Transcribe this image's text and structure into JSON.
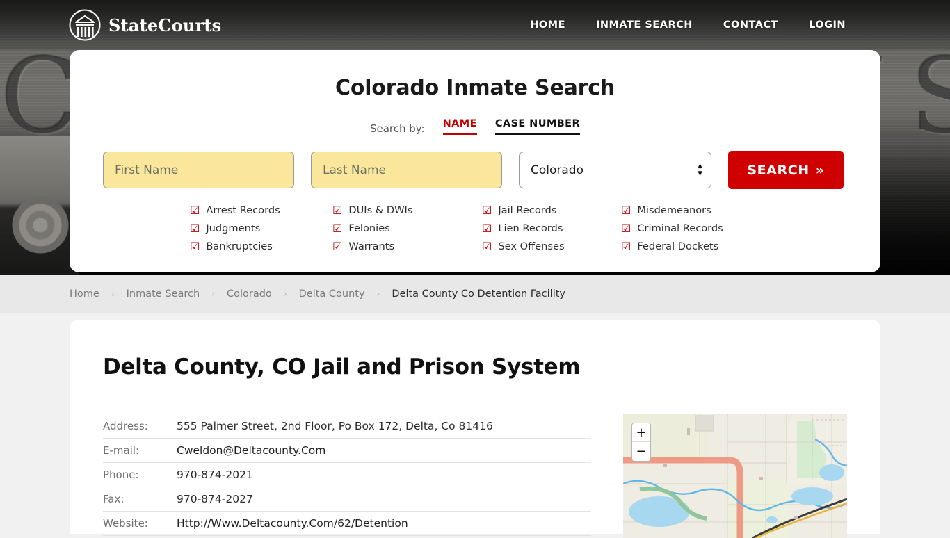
{
  "header": {
    "brand_name": "StateCourts",
    "brand_icon": "courthouse-circle-icon",
    "nav": [
      {
        "label": "HOME"
      },
      {
        "label": "INMATE SEARCH"
      },
      {
        "label": "CONTACT"
      },
      {
        "label": "LOGIN"
      }
    ]
  },
  "hero": {
    "background_text": "COURT HOUSE"
  },
  "search_card": {
    "title": "Colorado Inmate Search",
    "search_by_label": "Search by:",
    "tabs": [
      {
        "label": "NAME",
        "active": true
      },
      {
        "label": "CASE NUMBER",
        "active": false
      }
    ],
    "first_name_placeholder": "First Name",
    "first_name_value": "",
    "last_name_placeholder": "Last Name",
    "last_name_value": "",
    "state_value": "Colorado",
    "state_options": [
      "Colorado"
    ],
    "search_button": "SEARCH",
    "search_button_chevron": "»",
    "checkbox_glyph": "☑",
    "record_types": [
      "Arrest Records",
      "DUIs & DWIs",
      "Jail Records",
      "Misdemeanors",
      "Judgments",
      "Felonies",
      "Lien Records",
      "Criminal Records",
      "Bankruptcies",
      "Warrants",
      "Sex Offenses",
      "Federal Dockets"
    ],
    "accent_red": "#c00000",
    "button_red": "#d10000",
    "field_yellow": "#fae79b"
  },
  "breadcrumb": {
    "separator": "›",
    "items": [
      {
        "label": "Home",
        "current": false
      },
      {
        "label": "Inmate Search",
        "current": false
      },
      {
        "label": "Colorado",
        "current": false
      },
      {
        "label": "Delta County",
        "current": false
      },
      {
        "label": "Delta County Co Detention Facility",
        "current": true
      }
    ]
  },
  "main": {
    "page_title": "Delta County, CO Jail and Prison System",
    "details": [
      {
        "label": "Address:",
        "value": "555 Palmer Street, 2nd Floor, Po Box 172, Delta, Co 81416",
        "link": false
      },
      {
        "label": "E-mail:",
        "value": "Cweldon@Deltacounty.Com",
        "link": true
      },
      {
        "label": "Phone:",
        "value": "970-874-2021",
        "link": false
      },
      {
        "label": "Fax:",
        "value": "970-874-2027",
        "link": false
      },
      {
        "label": "Website:",
        "value": "Http://Www.Deltacounty.Com/62/Detention",
        "link": true
      }
    ],
    "map": {
      "zoom_in_label": "+",
      "zoom_out_label": "−"
    }
  }
}
